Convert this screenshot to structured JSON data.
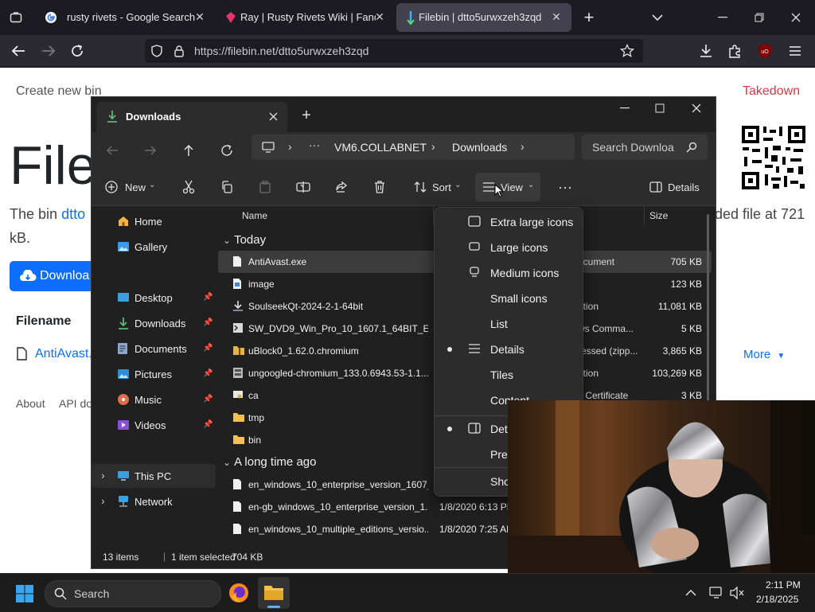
{
  "browser": {
    "tabs": [
      {
        "title": "rusty rivets - Google Search",
        "active": false
      },
      {
        "title": "Ray | Rusty Rivets Wiki | Fandom",
        "active": false
      },
      {
        "title": "Filebin | dtto5urwxzeh3zqd",
        "active": true
      }
    ],
    "url": "https://filebin.net/dtto5urwxzeh3zqd"
  },
  "page": {
    "create_link": "Create new bin",
    "takedown_link": "Takedown",
    "heading": "File",
    "desc_start": "The bin",
    "bin_link": "dtto",
    "desc_end": "ded file at 721",
    "desc_line2": "kB.",
    "download_button": "Downloa",
    "filename_header": "Filename",
    "file_link": "AntiAvast.",
    "more_link": "More",
    "footer_about": "About",
    "footer_api": "API do"
  },
  "explorer": {
    "tab_title": "Downloads",
    "breadcrumb": [
      "VM6.COLLABNET",
      "Downloads"
    ],
    "search_placeholder": "Search Downloa",
    "toolbar": {
      "new": "New",
      "sort": "Sort",
      "view": "View",
      "details": "Details"
    },
    "sidebar": [
      {
        "label": "Home",
        "icon": "home-icon"
      },
      {
        "label": "Gallery",
        "icon": "gallery-icon"
      },
      {
        "label": "Desktop",
        "icon": "desktop-icon",
        "pinned": true
      },
      {
        "label": "Downloads",
        "icon": "downloads-icon",
        "pinned": true
      },
      {
        "label": "Documents",
        "icon": "documents-icon",
        "pinned": true
      },
      {
        "label": "Pictures",
        "icon": "pictures-icon",
        "pinned": true
      },
      {
        "label": "Music",
        "icon": "music-icon",
        "pinned": true
      },
      {
        "label": "Videos",
        "icon": "videos-icon",
        "pinned": true
      },
      {
        "label": "This PC",
        "icon": "this-pc-icon"
      },
      {
        "label": "Network",
        "icon": "network-icon"
      }
    ],
    "columns": {
      "name": "Name",
      "size": "Size"
    },
    "groups": [
      "Today",
      "A long time ago"
    ],
    "files_today": [
      {
        "name": "AntiAvast.exe",
        "type": "ocument",
        "size": "705 KB",
        "selected": true
      },
      {
        "name": "image",
        "type": "e",
        "size": "123 KB"
      },
      {
        "name": "SoulseekQt-2024-2-1-64bit",
        "type": "ation",
        "size": "11,081 KB"
      },
      {
        "name": "SW_DVD9_Win_Pro_10_1607.1_64BIT_Eng...",
        "type": "ws Comma...",
        "size": "5 KB"
      },
      {
        "name": "uBlock0_1.62.0.chromium",
        "type": "ressed (zipp...",
        "size": "3,865 KB"
      },
      {
        "name": "ungoogled-chromium_133.0.6943.53-1.1...",
        "type": "ation",
        "size": "103,269 KB"
      },
      {
        "name": "ca",
        "type": "y Certificate",
        "size": "3 KB"
      },
      {
        "name": "tmp",
        "type": "",
        "size": ""
      },
      {
        "name": "bin",
        "type": "",
        "size": ""
      }
    ],
    "files_old": [
      {
        "name": "en_windows_10_enterprise_version_1607_...",
        "date": "",
        "type": "",
        "size": ""
      },
      {
        "name": "en-gb_windows_10_enterprise_version_1...",
        "date": "1/8/2020 6:13 PM",
        "type": "",
        "size": ""
      },
      {
        "name": "en_windows_10_multiple_editions_versio...",
        "date": "1/8/2020 7:25 AM",
        "type": "",
        "size": ""
      }
    ],
    "status": {
      "items": "13 items",
      "selected": "1 item selected",
      "size": "704 KB"
    }
  },
  "view_menu": {
    "items": [
      {
        "label": "Extra large icons",
        "icon": "extra-large-icons-icon",
        "bullet": false
      },
      {
        "label": "Large icons",
        "icon": "large-icons-icon",
        "bullet": false
      },
      {
        "label": "Medium icons",
        "icon": "medium-icons-icon",
        "bullet": false
      },
      {
        "label": "Small icons",
        "icon": "",
        "bullet": false
      },
      {
        "label": "List",
        "icon": "",
        "bullet": false
      },
      {
        "label": "Details",
        "icon": "details-icon",
        "bullet": true
      },
      {
        "label": "Tiles",
        "icon": "",
        "bullet": false
      },
      {
        "label": "Content",
        "icon": "",
        "bullet": false
      },
      {
        "label": "Deta",
        "icon": "details-pane-icon",
        "bullet": true
      },
      {
        "label": "Prev",
        "icon": "",
        "bullet": false
      },
      {
        "label": "Sho",
        "icon": "",
        "bullet": false
      }
    ]
  },
  "taskbar": {
    "search": "Search",
    "time": "2:11 PM",
    "date": "2/18/2025"
  },
  "colors": {
    "browser_bg": "#1c1b22",
    "explorer_bg": "#202020",
    "link_blue": "#0d6efd",
    "takedown_red": "#dc3545",
    "accent_green": "#5fb878"
  }
}
